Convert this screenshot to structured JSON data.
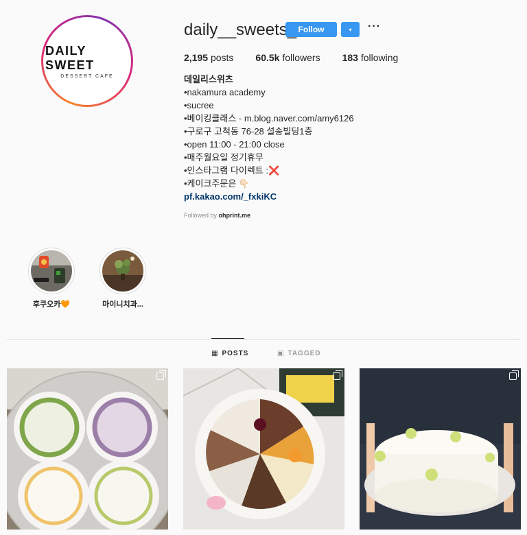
{
  "profile": {
    "logo_main": "DAILY SWEET",
    "logo_sub": "DESSERT CAFE",
    "username": "daily__sweets_",
    "follow_label": "Follow",
    "dropdown_glyph": "▾",
    "more_glyph": "···"
  },
  "stats": [
    {
      "count": "2,195",
      "label": "posts"
    },
    {
      "count": "60.5k",
      "label": "followers"
    },
    {
      "count": "183",
      "label": "following"
    }
  ],
  "bio": {
    "name": "데일리스위츠",
    "lines": [
      "•nakamura academy",
      "•sucree",
      "•베이킹클래스 - m.blog.naver.com/amy6126",
      "•구로구 고척동 76-28 설송빌딩1층",
      "•open 11:00 - 21:00 close",
      "•매주월요일 정기휴무",
      "•인스타그램 다이렉트 :❌",
      "•케이크주문은 👇🏻"
    ],
    "link": "pf.kakao.com/_fxkiKC",
    "followed_by_prefix": "Followed by",
    "followed_by_user": "ohprint.me"
  },
  "highlights": [
    {
      "label": "후쿠오카🧡"
    },
    {
      "label": "마이니치과..."
    }
  ],
  "tabs": [
    {
      "label": "POSTS",
      "icon": "grid-icon",
      "active": true
    },
    {
      "label": "TAGGED",
      "icon": "tag-icon",
      "active": false
    }
  ],
  "colors": {
    "accent": "#3897f0",
    "link": "#003569",
    "muted": "#8e8e8e"
  }
}
